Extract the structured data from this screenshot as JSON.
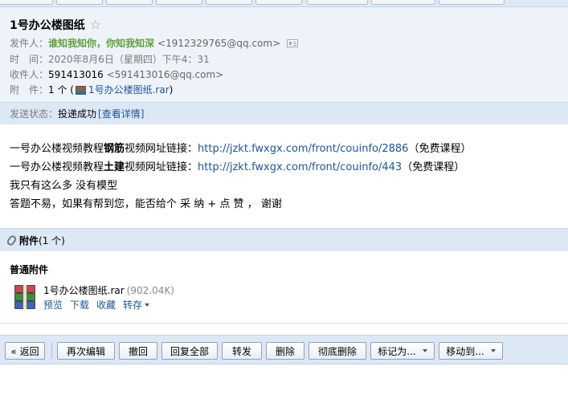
{
  "email": {
    "subject": "1号办公楼图纸",
    "sender": {
      "label": "发件人：",
      "name": "谁知我知你，你知我知深",
      "address": "<1912329765@qq.com>"
    },
    "time": {
      "label": "时　间：",
      "value": "2020年8月6日（星期四）下午4：31"
    },
    "recipient": {
      "label": "收件人：",
      "name": "591413016",
      "address": "<591413016@qq.com>"
    },
    "attachment_line": {
      "label": "附　件：",
      "count_prefix": "1 个 (",
      "file_link": "1号办公楼图纸.rar",
      "suffix": ")"
    },
    "status": {
      "label": "发送状态：",
      "value": "投递成功",
      "detail_link": "[查看详情]"
    },
    "body": {
      "line1": {
        "prefix": "一号办公楼视频教程",
        "bold": "钢筋",
        "middle": "视频网址链接：",
        "url": "http://jzkt.fwxgx.com/front/couinfo/2886",
        "suffix": "（免费课程）"
      },
      "line2": {
        "prefix": "一号办公楼视频教程",
        "bold": "土建",
        "middle": "视频网址链接：",
        "url": "http://jzkt.fwxgx.com/front/couinfo/443",
        "suffix": "（免费课程）"
      },
      "line3": "我只有这么多 没有模型",
      "line4": "答题不易，如果有帮到您，能否给个 采 纳 + 点 赞  ， 谢谢"
    }
  },
  "attachments": {
    "title": "附件",
    "count": "(1 个)",
    "section_label": "普通附件",
    "file": {
      "name": "1号办公楼图纸.rar",
      "size": "(902.04K)",
      "actions": [
        "预览",
        "下载",
        "收藏",
        "转存"
      ]
    }
  },
  "toolbar": {
    "back": "« 返回",
    "reedit": "再次编辑",
    "recall": "撤回",
    "reply_all": "回复全部",
    "forward": "转发",
    "delete": "删除",
    "delete_forever": "彻底删除",
    "mark_as": "标记为...",
    "move_to": "移动到..."
  }
}
